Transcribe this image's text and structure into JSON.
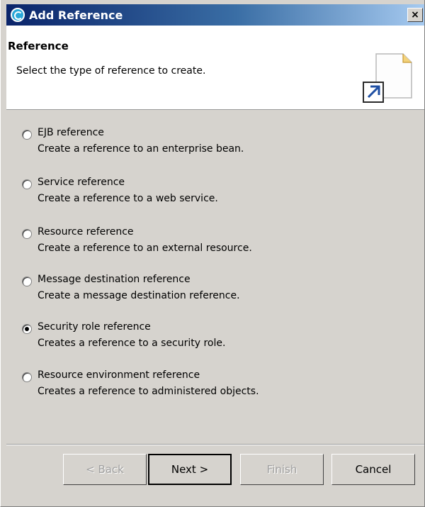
{
  "window": {
    "title": "Add Reference",
    "close_label": "×"
  },
  "header": {
    "title": "Reference",
    "description": "Select the type of reference to create."
  },
  "options": [
    {
      "label": "EJB reference",
      "description": "Create a reference to an enterprise bean.",
      "selected": false
    },
    {
      "label": "Service reference",
      "description": "Create a reference to a web service.",
      "selected": false
    },
    {
      "label": "Resource reference",
      "description": "Create a reference to an external resource.",
      "selected": false
    },
    {
      "label": "Message destination reference",
      "description": "Create a message destination reference.",
      "selected": false
    },
    {
      "label": "Security role reference",
      "description": "Creates a reference to a security role.",
      "selected": true
    },
    {
      "label": "Resource environment reference",
      "description": "Creates a reference to administered objects.",
      "selected": false
    }
  ],
  "buttons": {
    "back": "< Back",
    "next": "Next >",
    "finish": "Finish",
    "cancel": "Cancel"
  },
  "colors": {
    "title_bar_start": "#0a246a",
    "title_bar_end": "#a6caf0",
    "dialog_background": "#d6d3ce"
  },
  "icons": {
    "app": "eclipse-wizard-icon",
    "header": "new-reference-document-icon"
  }
}
